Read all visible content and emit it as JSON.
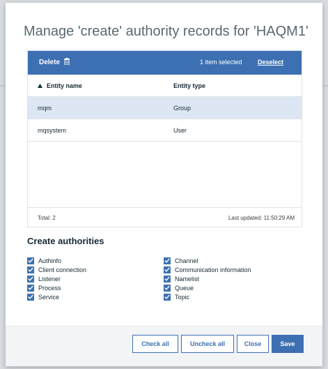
{
  "dialog": {
    "title": "Manage 'create' authority records for 'HAQM1'"
  },
  "table": {
    "toolbar": {
      "delete_label": "Delete",
      "selection_text": "1 item selected",
      "deselect_label": "Deselect"
    },
    "columns": [
      "Entity name",
      "Entity type"
    ],
    "rows": [
      {
        "name": "mqm",
        "type": "Group",
        "selected": true
      },
      {
        "name": "mqsystem",
        "type": "User",
        "selected": false
      }
    ],
    "footer": {
      "total": "Total: 2",
      "last_updated": "Last updated: 11:50:29 AM"
    }
  },
  "authorities": {
    "title": "Create authorities",
    "left": [
      "Authinfo",
      "Client connection",
      "Listener",
      "Process",
      "Service"
    ],
    "right": [
      "Channel",
      "Communication information",
      "Namelist",
      "Queue",
      "Topic"
    ],
    "checked": true
  },
  "buttons": {
    "check_all": "Check all",
    "uncheck_all": "Uncheck all",
    "close": "Close",
    "save": "Save"
  },
  "colors": {
    "accent": "#3d70b2",
    "selected_row": "#dde6f3"
  },
  "icons": {
    "delete": "trash-icon",
    "sort": "sort-ascending-icon",
    "checkbox": "checkmark-icon"
  }
}
